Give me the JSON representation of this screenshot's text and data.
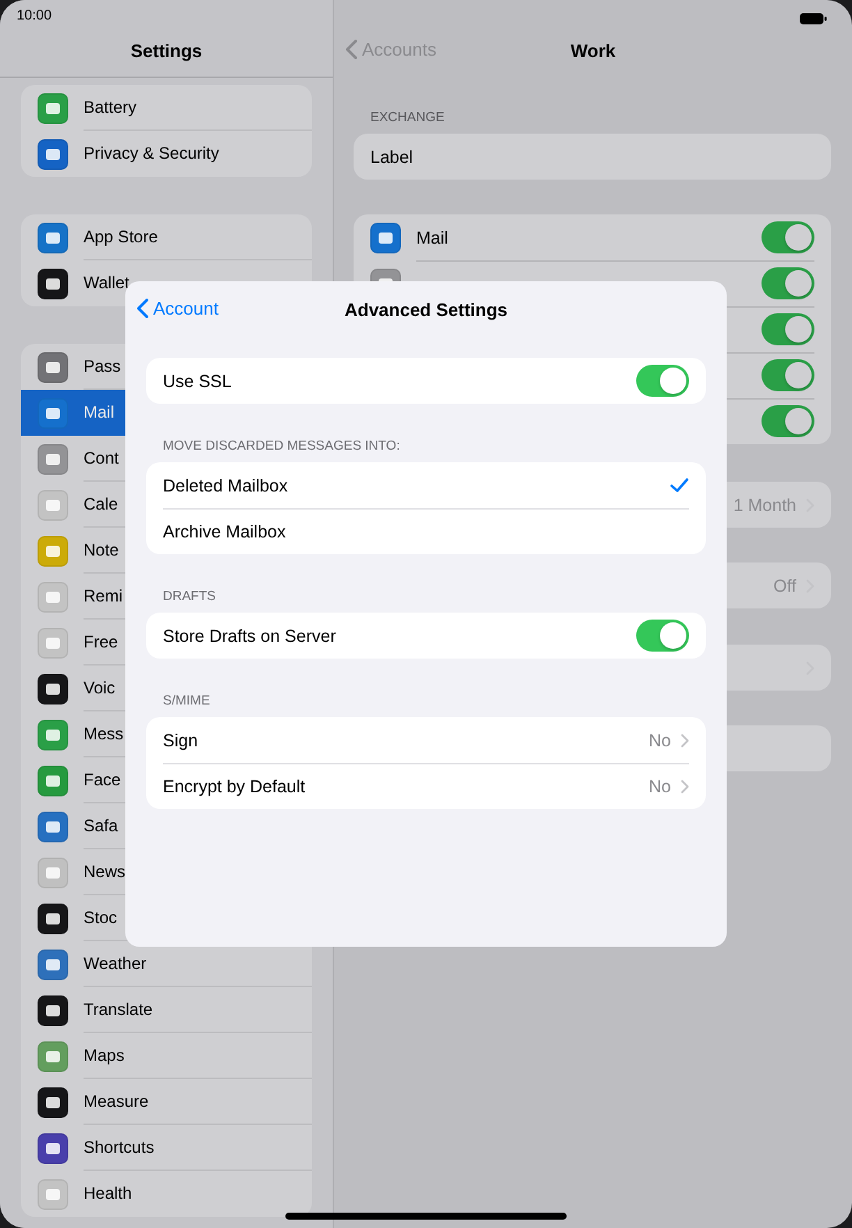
{
  "status_bar": {
    "time": "10:00"
  },
  "sidebar": {
    "title": "Settings",
    "groups": [
      {
        "items": [
          {
            "label": "Battery",
            "color": "#2a9f47",
            "selected": false
          },
          {
            "label": "Privacy & Security",
            "color": "#1563c4",
            "selected": false
          }
        ]
      },
      {
        "items": [
          {
            "label": "App Store",
            "color": "#1672c7",
            "selected": false
          },
          {
            "label": "Wallet",
            "color": "#161618",
            "selected": false
          }
        ]
      },
      {
        "items": [
          {
            "label": "Pass",
            "color": "#727276",
            "selected": false
          },
          {
            "label": "Mail",
            "color": "#1570cc",
            "selected": true
          },
          {
            "label": "Cont",
            "color": "#939396",
            "selected": false
          },
          {
            "label": "Cale",
            "color": "#c3c3c3",
            "selected": false
          },
          {
            "label": "Note",
            "color": "#ccab08",
            "selected": false
          },
          {
            "label": "Remi",
            "color": "#c3c3c3",
            "selected": false
          },
          {
            "label": "Free",
            "color": "#c3c3c3",
            "selected": false
          },
          {
            "label": "Voic",
            "color": "#161618",
            "selected": false
          },
          {
            "label": "Mess",
            "color": "#2a9f47",
            "selected": false
          },
          {
            "label": "Face",
            "color": "#269a3f",
            "selected": false
          },
          {
            "label": "Safa",
            "color": "#2670c0",
            "selected": false
          },
          {
            "label": "News",
            "color": "#c0c0c0",
            "selected": false
          },
          {
            "label": "Stoc",
            "color": "#161618",
            "selected": false
          },
          {
            "label": "Weather",
            "color": "#2e70ba",
            "selected": false
          },
          {
            "label": "Translate",
            "color": "#161618",
            "selected": false
          },
          {
            "label": "Maps",
            "color": "#639e5e",
            "selected": false
          },
          {
            "label": "Measure",
            "color": "#161618",
            "selected": false
          },
          {
            "label": "Shortcuts",
            "color": "#493fab",
            "selected": false
          },
          {
            "label": "Health",
            "color": "#c3c3c3",
            "selected": false
          }
        ]
      }
    ]
  },
  "detail": {
    "back": "Accounts",
    "title": "Work",
    "section_header": "EXCHANGE",
    "label_row": "Label",
    "toggle_rows": [
      {
        "label": "Mail",
        "color": "#1570cc",
        "on": true
      },
      {
        "color": "#939396",
        "on": true
      },
      {
        "on": true
      },
      {
        "on": true
      },
      {
        "on": true
      }
    ],
    "value_rows": [
      {
        "kind": "value",
        "value": "1 Month"
      },
      {
        "kind": "value",
        "value": "Off"
      },
      {
        "kind": "link"
      },
      {
        "kind": "blank"
      }
    ]
  },
  "modal": {
    "back": "Account",
    "title": "Advanced Settings",
    "sections": [
      {
        "rows": [
          {
            "kind": "toggle",
            "label": "Use SSL",
            "on": true
          }
        ]
      },
      {
        "header": "MOVE DISCARDED MESSAGES INTO:",
        "rows": [
          {
            "kind": "choice",
            "label": "Deleted Mailbox",
            "selected": true
          },
          {
            "kind": "choice",
            "label": "Archive Mailbox",
            "selected": false
          }
        ]
      },
      {
        "header": "DRAFTS",
        "rows": [
          {
            "kind": "toggle",
            "label": "Store Drafts on Server",
            "on": true
          }
        ]
      },
      {
        "header": "S/MIME",
        "rows": [
          {
            "kind": "value",
            "label": "Sign",
            "value": "No"
          },
          {
            "kind": "value",
            "label": "Encrypt by Default",
            "value": "No"
          }
        ]
      }
    ]
  }
}
